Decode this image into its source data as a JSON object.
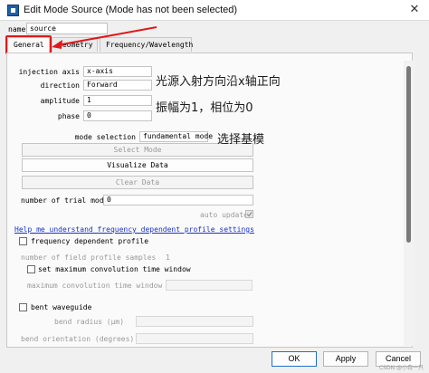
{
  "window": {
    "title": "Edit Mode Source (Mode has not been selected)",
    "close_glyph": "✕"
  },
  "name": {
    "label": "name",
    "value": "source"
  },
  "tabs": [
    {
      "label": "General"
    },
    {
      "label": "Geometry"
    },
    {
      "label": "Frequency/Wavelength"
    }
  ],
  "fields": {
    "injection_axis": {
      "label": "injection axis",
      "value": "x-axis"
    },
    "direction": {
      "label": "direction",
      "value": "Forward"
    },
    "amplitude": {
      "label": "amplitude",
      "value": "1"
    },
    "phase": {
      "label": "phase",
      "value": "0"
    },
    "mode_selection": {
      "label": "mode selection",
      "value": "fundamental mode"
    },
    "trial_modes": {
      "label": "number of trial modes",
      "value": "0"
    }
  },
  "buttons": {
    "select_mode": "Select Mode",
    "visualize_data": "Visualize Data",
    "clear_data": "Clear Data",
    "ok": "OK",
    "apply": "Apply",
    "cancel": "Cancel"
  },
  "auto_update": {
    "label": "auto update",
    "checked": true
  },
  "help_link": "Help me understand frequency dependent profile settings",
  "frequency_profile": {
    "checkbox_label": "frequency dependent profile",
    "samples_label": "number of field profile samples",
    "samples_value": "1",
    "max_conv_label": "set maximum convolution time window",
    "max_conv_field_label": "maximum convolution time window (fs)"
  },
  "bent_waveguide": {
    "checkbox_label": "bent waveguide",
    "bend_radius_label": "bend radius (μm)",
    "bend_orientation_label": "bend orientation (degrees)"
  },
  "annotations": {
    "line1": "光源入射方向沿x轴正向",
    "line2": "振幅为1，相位为0",
    "line3": "选择基模",
    "color": "#e01919"
  },
  "watermark": "CSDN @小白一只"
}
